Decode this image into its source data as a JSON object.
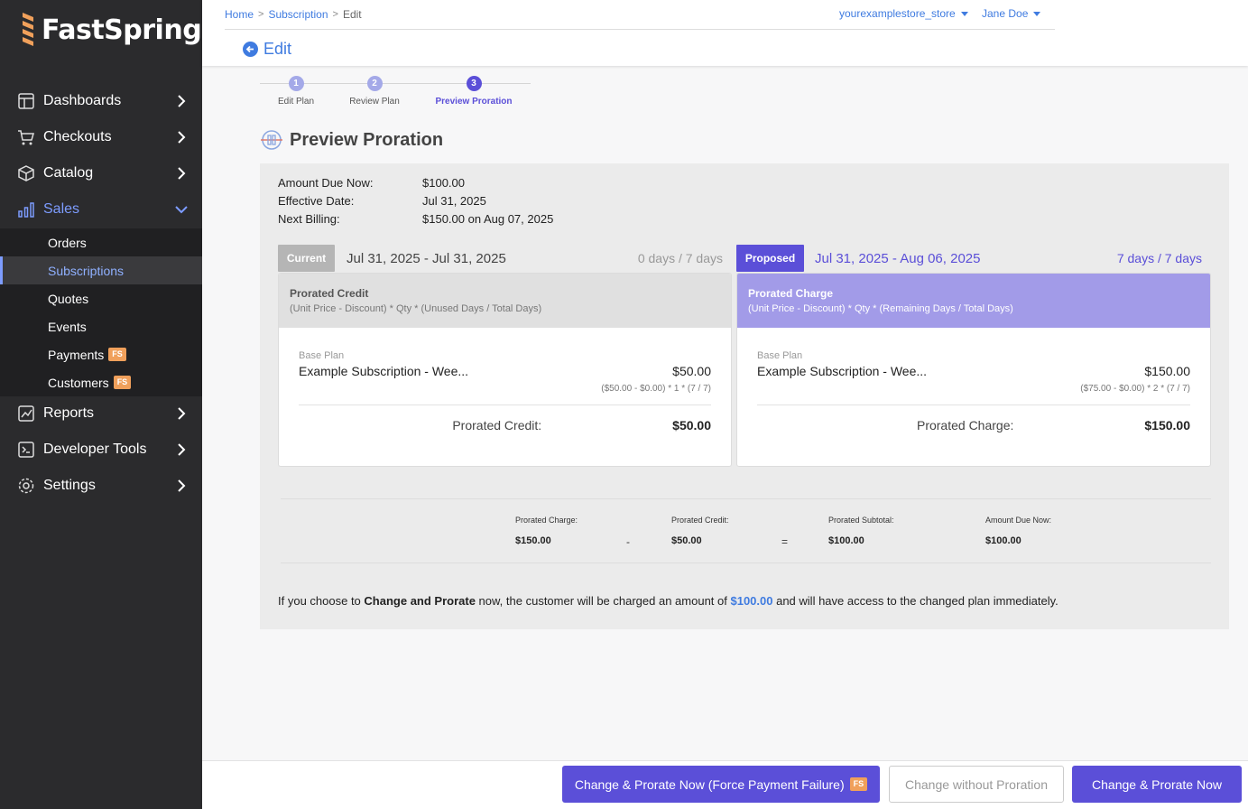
{
  "brand": {
    "name": "FastSpring"
  },
  "nav": {
    "dashboards": "Dashboards",
    "checkouts": "Checkouts",
    "catalog": "Catalog",
    "sales": "Sales",
    "sales_sub": {
      "orders": "Orders",
      "subscriptions": "Subscriptions",
      "quotes": "Quotes",
      "events": "Events",
      "payments": "Payments",
      "customers": "Customers",
      "badge": "FS"
    },
    "reports": "Reports",
    "developer_tools": "Developer Tools",
    "settings": "Settings"
  },
  "header": {
    "breadcrumb": {
      "home": "Home",
      "subscription": "Subscription",
      "current": "Edit"
    },
    "store": "yourexamplestore_store",
    "user": "Jane Doe",
    "back_label": "Edit"
  },
  "steps": [
    {
      "num": "1",
      "label": "Edit Plan"
    },
    {
      "num": "2",
      "label": "Review Plan"
    },
    {
      "num": "3",
      "label": "Preview Proration"
    }
  ],
  "page_title": "Preview Proration",
  "summary": {
    "amount_due_label": "Amount Due Now:",
    "amount_due_value": "$100.00",
    "effective_label": "Effective Date:",
    "effective_value": "Jul 31, 2025",
    "next_billing_label": "Next Billing:",
    "next_billing_value": "$150.00 on Aug 07, 2025"
  },
  "current": {
    "tag": "Current",
    "range": "Jul 31, 2025 - Jul 31, 2025",
    "days": "0 days / 7 days",
    "card_title": "Prorated Credit",
    "card_formula": "(Unit Price - Discount) * Qty * (Unused Days / Total Days)",
    "base_plan_label": "Base Plan",
    "product": "Example Subscription - Wee...",
    "price": "$50.00",
    "line_formula": "($50.00 - $0.00) * 1 * (7 / 7)",
    "total_label": "Prorated Credit:",
    "total_value": "$50.00"
  },
  "proposed": {
    "tag": "Proposed",
    "range": "Jul 31, 2025 - Aug 06, 2025",
    "days": "7 days / 7 days",
    "card_title": "Prorated Charge",
    "card_formula": "(Unit Price - Discount) * Qty * (Remaining Days / Total Days)",
    "base_plan_label": "Base Plan",
    "product": "Example Subscription - Wee...",
    "price": "$150.00",
    "line_formula": "($75.00 - $0.00) * 2 * (7 / 7)",
    "total_label": "Prorated Charge:",
    "total_value": "$150.00"
  },
  "calc": {
    "charge_label": "Prorated Charge:",
    "charge_value": "$150.00",
    "minus": "-",
    "credit_label": "Prorated Credit:",
    "credit_value": "$50.00",
    "equals": "=",
    "subtotal_label": "Prorated Subtotal:",
    "subtotal_value": "$100.00",
    "due_label": "Amount Due Now:",
    "due_value": "$100.00"
  },
  "notice": {
    "prefix": "If you choose to ",
    "action": "Change and Prorate",
    "middle": " now, the customer will be charged an amount of ",
    "amount": "$100.00",
    "suffix": " and will have access to the changed plan immediately."
  },
  "footer": {
    "force_failure": "Change & Prorate Now (Force Payment Failure)",
    "force_badge": "FS",
    "without_proration": "Change without Proration",
    "prorate_now": "Change & Prorate Now"
  },
  "colors": {
    "accent": "#5b4fd8",
    "link": "#3f7be0",
    "sidebar_bg": "#2b2b2d",
    "badge": "#f0a05b"
  }
}
